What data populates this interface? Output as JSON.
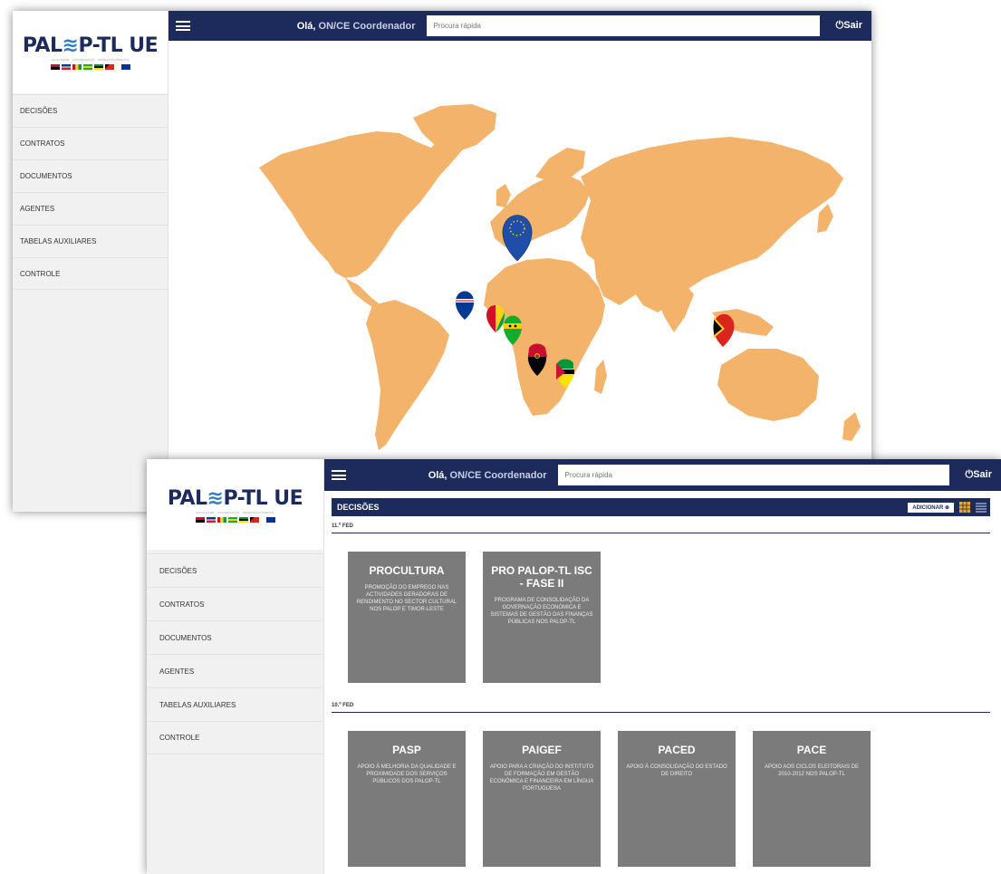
{
  "app": {
    "logo_text_left": "PAL",
    "logo_text_right": "P-TL UE",
    "logo_sub": "IGUALDADE · COOPERAÇÃO · DESENVOLVIMENTO"
  },
  "sidebar": {
    "items": [
      {
        "label": "DECISÕES"
      },
      {
        "label": "CONTRATOS"
      },
      {
        "label": "DOCUMENTOS"
      },
      {
        "label": "AGENTES"
      },
      {
        "label": "TABELAS AUXILIARES"
      },
      {
        "label": "CONTROLE"
      }
    ]
  },
  "header": {
    "greeting": "Olá,",
    "user": "ON/CE Coordenador",
    "search_placeholder": "Procura rápida",
    "logout_label": "Sair"
  },
  "colors": {
    "navy": "#1d2a5c",
    "map_land": "#f3b36a",
    "card_bg": "#7b7b7b"
  },
  "map": {
    "markers": [
      "eu-flag-marker",
      "cabo-verde-flag-marker",
      "guine-bissau-flag-marker",
      "sao-tome-flag-marker",
      "angola-flag-marker",
      "mozambique-flag-marker",
      "timor-leste-flag-marker"
    ]
  },
  "decisions": {
    "title": "DECISÕES",
    "add_label": "ADICIONAR",
    "groups": [
      {
        "label": "11.º FED",
        "cards": [
          {
            "title": "PROCULTURA",
            "desc": "PROMOÇÃO DO EMPREGO NAS ACTIVIDADES GERADORAS DE RENDIMENTO NO SECTOR CULTURAL NOS PALOP E TIMOR-LESTE"
          },
          {
            "title": "PRO PALOP-TL ISC - FASE II",
            "desc": "PROGRAMA DE CONSOLIDAÇÃO DA GOVERNAÇÃO ECONÓMICA E SISTEMAS DE GESTÃO DAS FINANÇAS PÚBLICAS NOS PALOP-TL"
          }
        ]
      },
      {
        "label": "10.º FED",
        "cards": [
          {
            "title": "PASP",
            "desc": "APOIO À MELHORIA DA QUALIDADE E PROXIMIDADE DOS SERVIÇOS PÚBLICOS DOS PALOP-TL"
          },
          {
            "title": "PAIGEF",
            "desc": "APOIO PARA A CRIAÇÃO DO INSTITUTO DE FORMAÇÃO EM GESTÃO ECONÓMICA E FINANCEIRA EM LÍNGUA PORTUGUESA"
          },
          {
            "title": "PACED",
            "desc": "APOIO À CONSOLIDAÇÃO DO ESTADO DE DIREITO"
          },
          {
            "title": "PACE",
            "desc": "APOIO AOS CICLOS ELEITORAIS DE 2010-2012 NOS PALOP-TL"
          }
        ]
      }
    ]
  }
}
